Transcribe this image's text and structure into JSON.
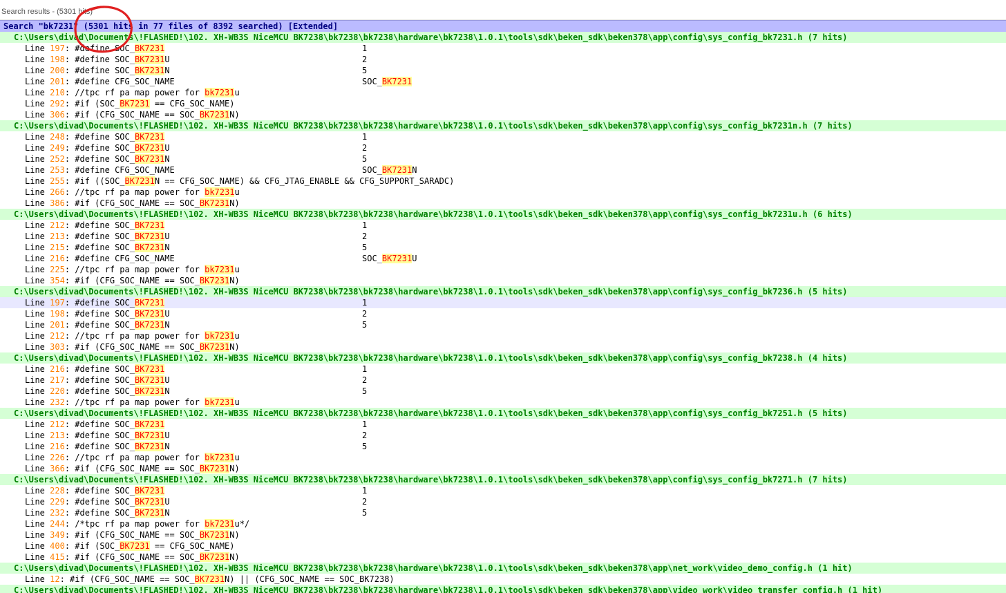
{
  "window": {
    "title": "Search results - (5301 hits)"
  },
  "search_header": "Search \"bk7231\" (5301 hits in 77 files of 8392 searched) [Extended]",
  "files": [
    {
      "path": "C:\\Users\\divad\\Documents\\!FLASHED!\\102. XH-WB3S NiceMCU BK7238\\bk7238\\bk7238\\hardware\\bk7238\\1.0.1\\tools\\sdk\\beken_sdk\\beken378\\app\\config\\sys_config_bk7231.h (7 hits)",
      "lines": [
        {
          "num": "197",
          "code": "#define SOC_BK7231",
          "value": "1"
        },
        {
          "num": "198",
          "code": "#define SOC_BK7231U",
          "value": "2"
        },
        {
          "num": "200",
          "code": "#define SOC_BK7231N",
          "value": "5"
        },
        {
          "num": "201",
          "code": "#define CFG_SOC_NAME",
          "value": "SOC_BK7231"
        },
        {
          "num": "210",
          "code": "//tpc rf pa map power for bk7231u",
          "value": ""
        },
        {
          "num": "292",
          "code": "#if (SOC_BK7231 == CFG_SOC_NAME)",
          "value": ""
        },
        {
          "num": "306",
          "code": "#if (CFG_SOC_NAME == SOC_BK7231N)",
          "value": ""
        }
      ]
    },
    {
      "path": "C:\\Users\\divad\\Documents\\!FLASHED!\\102. XH-WB3S NiceMCU BK7238\\bk7238\\bk7238\\hardware\\bk7238\\1.0.1\\tools\\sdk\\beken_sdk\\beken378\\app\\config\\sys_config_bk7231n.h (7 hits)",
      "lines": [
        {
          "num": "248",
          "code": "#define SOC_BK7231",
          "value": "1"
        },
        {
          "num": "249",
          "code": "#define SOC_BK7231U",
          "value": "2"
        },
        {
          "num": "252",
          "code": "#define SOC_BK7231N",
          "value": "5"
        },
        {
          "num": "253",
          "code": "#define CFG_SOC_NAME",
          "value": "SOC_BK7231N"
        },
        {
          "num": "255",
          "code": "#if ((SOC_BK7231N == CFG_SOC_NAME) && CFG_JTAG_ENABLE && CFG_SUPPORT_SARADC)",
          "value": ""
        },
        {
          "num": "266",
          "code": "//tpc rf pa map power for bk7231u",
          "value": ""
        },
        {
          "num": "386",
          "code": "#if (CFG_SOC_NAME == SOC_BK7231N)",
          "value": ""
        }
      ]
    },
    {
      "path": "C:\\Users\\divad\\Documents\\!FLASHED!\\102. XH-WB3S NiceMCU BK7238\\bk7238\\bk7238\\hardware\\bk7238\\1.0.1\\tools\\sdk\\beken_sdk\\beken378\\app\\config\\sys_config_bk7231u.h (6 hits)",
      "lines": [
        {
          "num": "212",
          "code": "#define SOC_BK7231",
          "value": "1"
        },
        {
          "num": "213",
          "code": "#define SOC_BK7231U",
          "value": "2"
        },
        {
          "num": "215",
          "code": "#define SOC_BK7231N",
          "value": "5"
        },
        {
          "num": "216",
          "code": "#define CFG_SOC_NAME",
          "value": "SOC_BK7231U"
        },
        {
          "num": "225",
          "code": "//tpc rf pa map power for bk7231u",
          "value": ""
        },
        {
          "num": "354",
          "code": "#if (CFG_SOC_NAME == SOC_BK7231N)",
          "value": ""
        }
      ]
    },
    {
      "path": "C:\\Users\\divad\\Documents\\!FLASHED!\\102. XH-WB3S NiceMCU BK7238\\bk7238\\bk7238\\hardware\\bk7238\\1.0.1\\tools\\sdk\\beken_sdk\\beken378\\app\\config\\sys_config_bk7236.h (5 hits)",
      "lines": [
        {
          "num": "197",
          "code": "#define SOC_BK7231",
          "value": "1",
          "selected": true
        },
        {
          "num": "198",
          "code": "#define SOC_BK7231U",
          "value": "2"
        },
        {
          "num": "201",
          "code": "#define SOC_BK7231N",
          "value": "5"
        },
        {
          "num": "212",
          "code": "//tpc rf pa map power for bk7231u",
          "value": ""
        },
        {
          "num": "303",
          "code": "#if (CFG_SOC_NAME == SOC_BK7231N)",
          "value": ""
        }
      ]
    },
    {
      "path": "C:\\Users\\divad\\Documents\\!FLASHED!\\102. XH-WB3S NiceMCU BK7238\\bk7238\\bk7238\\hardware\\bk7238\\1.0.1\\tools\\sdk\\beken_sdk\\beken378\\app\\config\\sys_config_bk7238.h (4 hits)",
      "lines": [
        {
          "num": "216",
          "code": "#define SOC_BK7231",
          "value": "1"
        },
        {
          "num": "217",
          "code": "#define SOC_BK7231U",
          "value": "2"
        },
        {
          "num": "220",
          "code": "#define SOC_BK7231N",
          "value": "5"
        },
        {
          "num": "232",
          "code": "//tpc rf pa map power for bk7231u",
          "value": ""
        }
      ]
    },
    {
      "path": "C:\\Users\\divad\\Documents\\!FLASHED!\\102. XH-WB3S NiceMCU BK7238\\bk7238\\bk7238\\hardware\\bk7238\\1.0.1\\tools\\sdk\\beken_sdk\\beken378\\app\\config\\sys_config_bk7251.h (5 hits)",
      "lines": [
        {
          "num": "212",
          "code": "#define SOC_BK7231",
          "value": "1"
        },
        {
          "num": "213",
          "code": "#define SOC_BK7231U",
          "value": "2"
        },
        {
          "num": "216",
          "code": "#define SOC_BK7231N",
          "value": "5"
        },
        {
          "num": "226",
          "code": "//tpc rf pa map power for bk7231u",
          "value": ""
        },
        {
          "num": "366",
          "code": "#if (CFG_SOC_NAME == SOC_BK7231N)",
          "value": ""
        }
      ]
    },
    {
      "path": "C:\\Users\\divad\\Documents\\!FLASHED!\\102. XH-WB3S NiceMCU BK7238\\bk7238\\bk7238\\hardware\\bk7238\\1.0.1\\tools\\sdk\\beken_sdk\\beken378\\app\\config\\sys_config_bk7271.h (7 hits)",
      "lines": [
        {
          "num": "228",
          "code": "#define SOC_BK7231",
          "value": "1"
        },
        {
          "num": "229",
          "code": "#define SOC_BK7231U",
          "value": "2"
        },
        {
          "num": "232",
          "code": "#define SOC_BK7231N",
          "value": "5"
        },
        {
          "num": "244",
          "code": "/*tpc rf pa map power for bk7231u*/",
          "value": ""
        },
        {
          "num": "349",
          "code": "#if (CFG_SOC_NAME == SOC_BK7231N)",
          "value": ""
        },
        {
          "num": "400",
          "code": "#if (SOC_BK7231 == CFG_SOC_NAME)",
          "value": ""
        },
        {
          "num": "415",
          "code": "#if (CFG_SOC_NAME == SOC_BK7231N)",
          "value": ""
        }
      ]
    },
    {
      "path": "C:\\Users\\divad\\Documents\\!FLASHED!\\102. XH-WB3S NiceMCU BK7238\\bk7238\\bk7238\\hardware\\bk7238\\1.0.1\\tools\\sdk\\beken_sdk\\beken378\\app\\net_work\\video_demo_config.h (1 hit)",
      "lines": [
        {
          "num": "12",
          "code": "#if (CFG_SOC_NAME == SOC_BK7231N) || (CFG_SOC_NAME == SOC_BK7238)",
          "value": ""
        }
      ]
    },
    {
      "path": "C:\\Users\\divad\\Documents\\!FLASHED!\\102. XH-WB3S NiceMCU BK7238\\bk7238\\bk7238\\hardware\\bk7238\\1.0.1\\tools\\sdk\\beken_sdk\\beken378\\app\\video_work\\video_transfer_config.h (1 hit)",
      "lines": []
    }
  ],
  "line_prefix": "Line ",
  "highlight_term": "bk7231",
  "colors": {
    "search_bar_bg": "#bbbbff",
    "search_text": "#000080",
    "file_bar_bg": "#d5ffd5",
    "file_text": "#008000",
    "line_number": "#ff8000",
    "hit_text": "#ff0000",
    "hit_bg": "#ffff99",
    "selected_row_bg": "#e8e8ff",
    "annotation_circle": "#e02020"
  }
}
